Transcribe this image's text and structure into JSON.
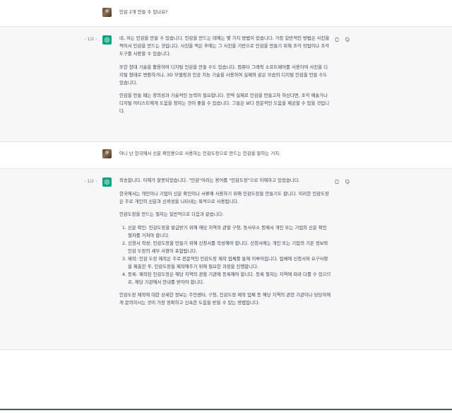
{
  "conversation": {
    "turns": [
      {
        "role": "user",
        "text": "인감 2개 만들 수 있나요?"
      },
      {
        "role": "assistant",
        "pager": {
          "current": "1/2",
          "prev_icon": "chevron-left-icon",
          "next_icon": "chevron-right-icon"
        },
        "paragraphs": [
          "네, 저는 인감을 만들 수 있습니다. 인감을 만드는 데에는 몇 가지 방법이 있습니다. 가장 일반적인 방법은 사진을 찍어서 인감을 만드는 것입니다. 사진을 찍은 후에는 그 사진을 기반으로 인감을 만들기 위해 조각 작업이나 조각 도구를 사용할 수 있습니다.",
          "또한 현대 기술을 활용하여 디지털 인감을 만들 수도 있습니다. 컴퓨터 그래픽 소프트웨어를 사용하여 사진을 디지털 형태로 변환하거나, 3D 모델링과 인공 지능 기술을 사용하여 실제와 같은 모습의 디지털 인감을 만들 수도 있습니다.",
          "인감을 만들 때는 창의성과 기술적인 능력이 필요합니다. 만약 실제로 인감을 만들고자 하신다면, 조각 예술가나 디지털 아티스트에게 도움을 청하는 것이 좋을 수 있습니다. 그들은 보다 전문적인 도움을 제공할 수 있을 것입니다."
        ]
      },
      {
        "role": "user",
        "text": "아니 난 한국에서 신분 확인용으로 사용하는 인감도장으로 만드는 인감을 말하는 거지."
      },
      {
        "role": "assistant",
        "pager": {
          "current": "1/2",
          "prev_icon": "chevron-left-icon",
          "next_icon": "chevron-right-icon"
        },
        "paragraphs": [
          "죄송합니다. 이해가 잘못되었습니다. \"인감\"이라는 용어를 \"인감도장\"으로 이해하고 있었습니다.",
          "한국에서는 개인이나 기업이 신분 확인이나 서류에 사용하기 위해 인감도장을 만들기도 합니다. 이러한 인감도장은 주로 개인의 신분과 신뢰성을 나타내는 목적으로 사용됩니다.",
          "인감도장을 만드는 절차는 일반적으로 다음과 같습니다:"
        ],
        "steps": [
          "신분 확인: 인감도장을 발급받기 위해 해당 지역의 관할 구청, 동사무소 등에서 개인 또는 기업의 신분 확인 절차를 거쳐야 합니다.",
          "신청서 작성: 인감도장을 만들기 위해 신청서를 작성해야 합니다. 신청서에는 개인 또는 기업의 기본 정보와 인감 도장의 세부 사항이 포함됩니다.",
          "제작: 인감 도장 제작은 주로 전문적인 인감도장 제작 업체를 통해 이루어집니다. 업체에 신청서와 요구사항을 제출한 후, 인감도장을 제작해주기 위해 필요한 과정을 진행합니다.",
          "등록: 제작된 인감도장은 해당 지역의 관할 기관에 등록해야 합니다. 등록 절차는 지역에 따라 다를 수 있으므로, 해당 기관에서 안내를 받아야 합니다."
        ],
        "closing": "인감도장 제작에 대한 상세한 정보는 주민센터, 구청, 인감도장 제작 업체 등 해당 지역의 관련 기관이나 담당자에게 문의하시는 것이 가장 정확하고 신속한 도움을 받을 수 있는 방법입니다."
      }
    ]
  },
  "icons": {
    "copy": "clipboard-icon",
    "dislike": "thumbs-down-icon",
    "assistant_avatar": "openai-logo-icon",
    "user_avatar": "user-photo-avatar"
  },
  "colors": {
    "assistant_bg": "#f7f7f8",
    "user_bg": "#ffffff",
    "brand": "#10a37f",
    "text": "#374151"
  }
}
